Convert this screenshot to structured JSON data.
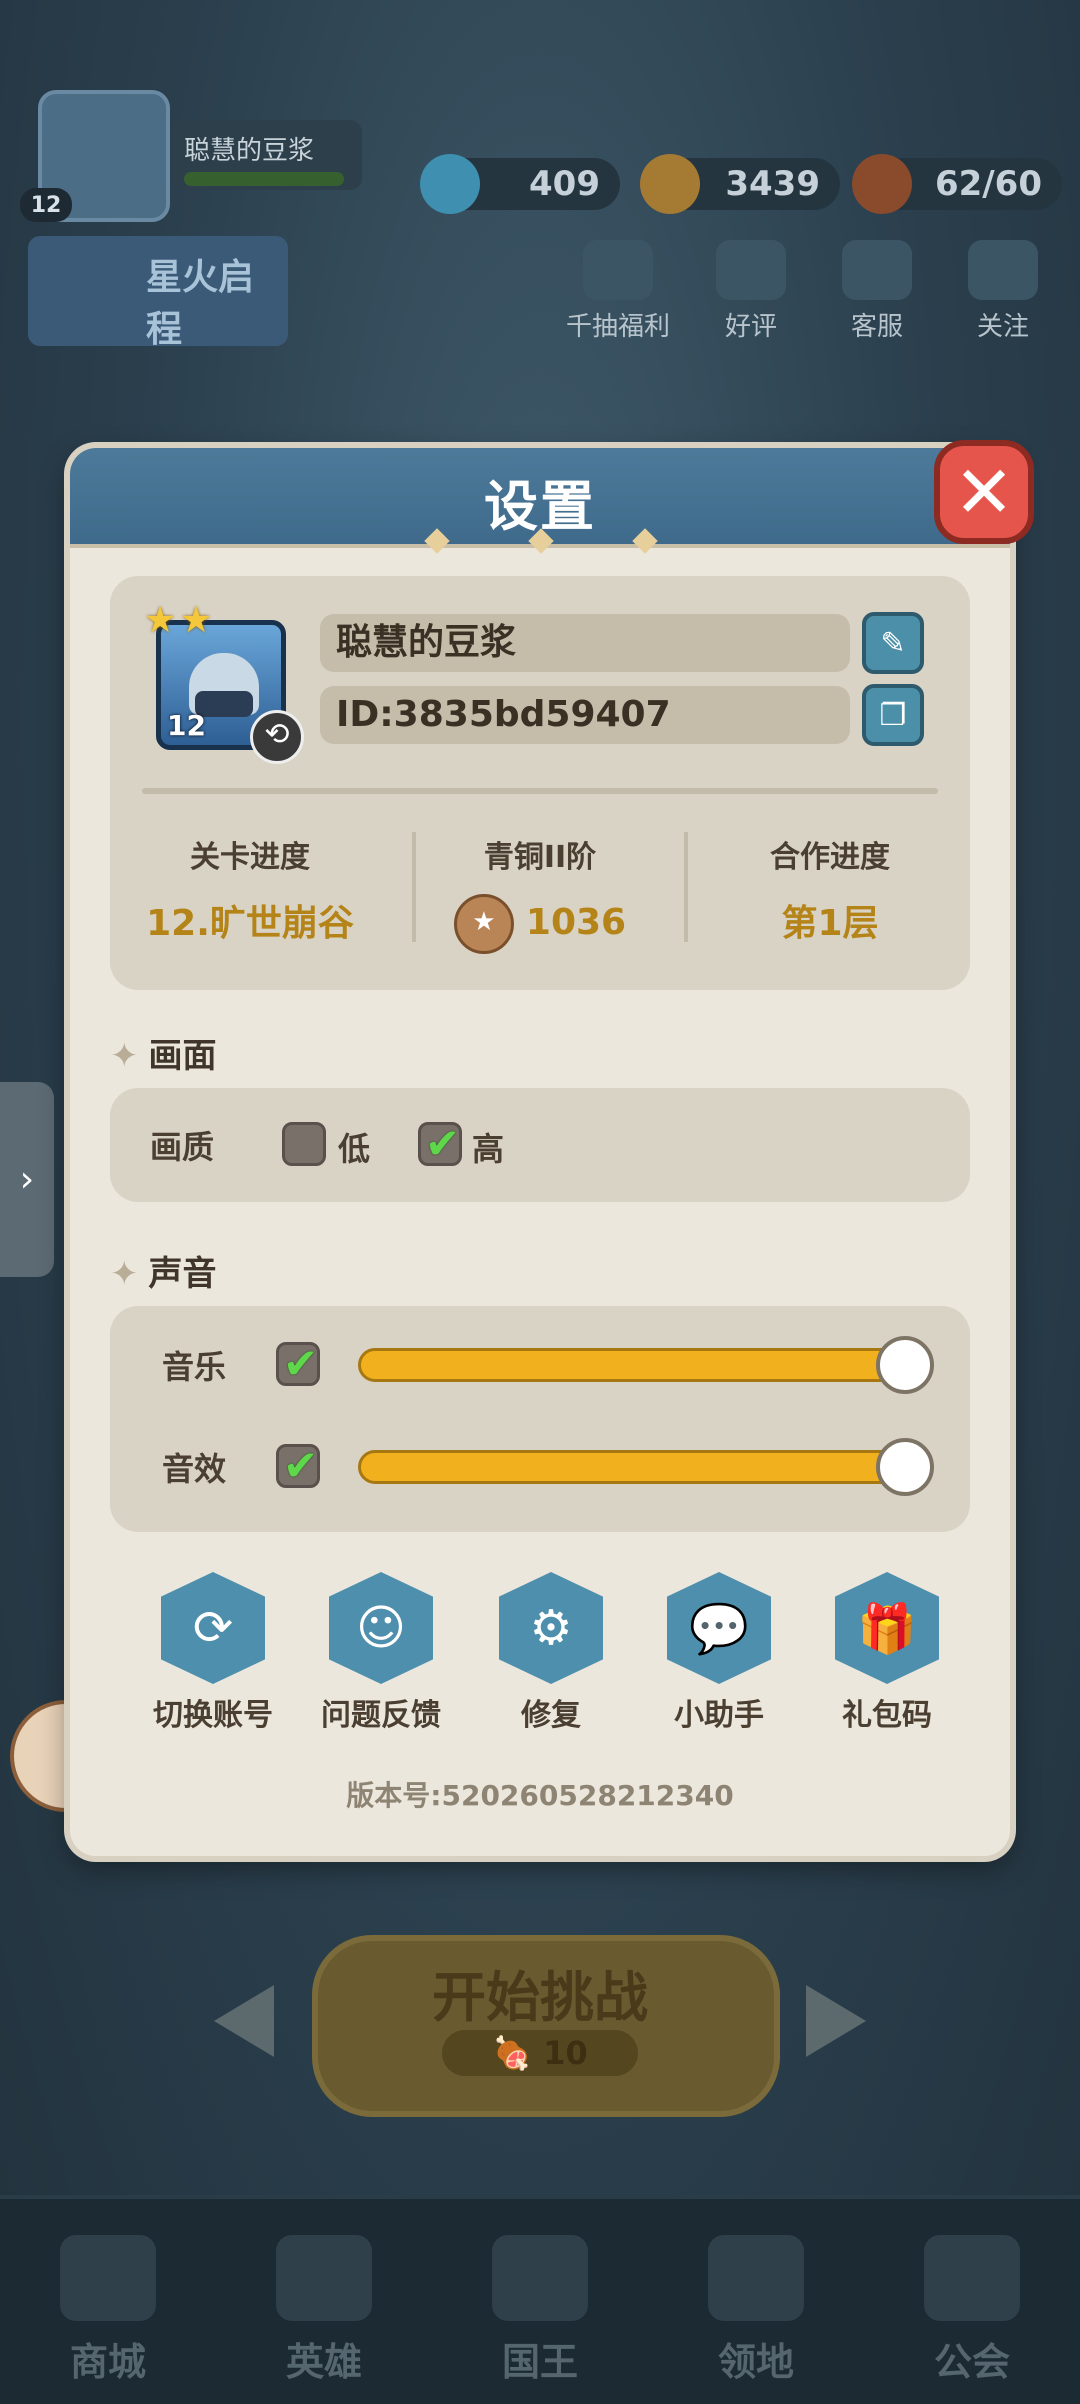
{
  "background": {
    "player": {
      "name": "聪慧的豆浆",
      "level": "12"
    },
    "resources": {
      "diamonds": "409",
      "coins": "3439",
      "stamina": "62/60"
    },
    "top_links": [
      "千抽福利",
      "好评",
      "客服",
      "关注"
    ],
    "event_banner": "星火启程",
    "start_button": {
      "label": "开始挑战",
      "cost": "10"
    },
    "bottom_nav": [
      "商城",
      "英雄",
      "国王",
      "领地",
      "公会"
    ]
  },
  "settings": {
    "title": "设置",
    "profile": {
      "name": "聪慧的豆浆",
      "id": "ID:3835bd59407",
      "hero_level": "12",
      "stats": [
        {
          "label": "关卡进度",
          "value": "12.旷世崩谷"
        },
        {
          "label": "青铜II阶",
          "value": "1036"
        },
        {
          "label": "合作进度",
          "value": "第1层"
        }
      ]
    },
    "graphics": {
      "section_title": "画面",
      "quality_label": "画质",
      "options": [
        {
          "label": "低",
          "checked": false
        },
        {
          "label": "高",
          "checked": true
        }
      ]
    },
    "sound": {
      "section_title": "声音",
      "music": {
        "label": "音乐",
        "enabled": true,
        "level": 1.0
      },
      "effects": {
        "label": "音效",
        "enabled": true,
        "level": 1.0
      }
    },
    "actions": [
      {
        "label": "切换账号",
        "icon": "refresh-icon"
      },
      {
        "label": "问题反馈",
        "icon": "feedback-icon"
      },
      {
        "label": "修复",
        "icon": "gear-icon"
      },
      {
        "label": "小助手",
        "icon": "chat-icon"
      },
      {
        "label": "礼包码",
        "icon": "gift-icon"
      }
    ],
    "version": "版本号:520260528212340"
  },
  "colors": {
    "accent": "#f1b11f",
    "header": "#4d7a9a",
    "action": "#4d8fac",
    "close": "#e6554b"
  }
}
